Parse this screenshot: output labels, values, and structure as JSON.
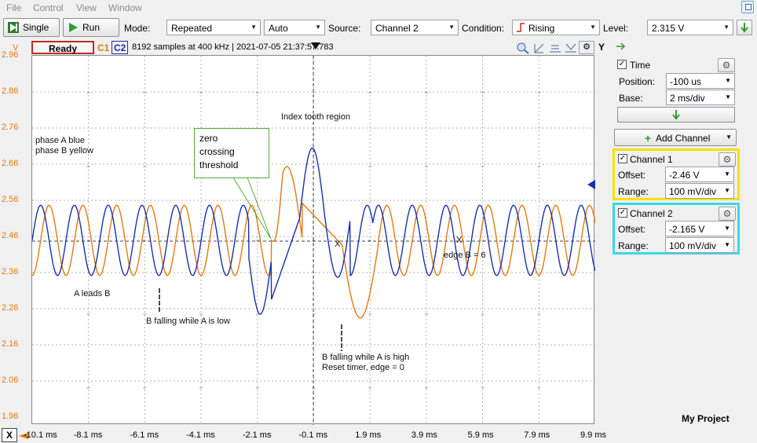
{
  "menu": {
    "file": "File",
    "control": "Control",
    "view": "View",
    "window": "Window"
  },
  "toolbar": {
    "single": "Single",
    "run": "Run",
    "mode_label": "Mode:",
    "mode_value": "Repeated",
    "auto_value": "Auto",
    "source_label": "Source:",
    "source_value": "Channel 2",
    "condition_label": "Condition:",
    "condition_value": "Rising",
    "level_label": "Level:",
    "level_value": "2.315 V"
  },
  "status": {
    "ready": "Ready",
    "c1": "C1",
    "c2": "C2",
    "samples": "8192 samples at 400 kHz | 2021-07-05 21:37:57.783",
    "vunit": "V",
    "y_button": "Y",
    "x_button": "X"
  },
  "annotations": {
    "phase_a": "phase A blue",
    "phase_b": "phase B yellow",
    "zero_1": "zero",
    "zero_2": "crossing",
    "zero_3": "threshold",
    "index": "Index tooth region",
    "a_leads": "A leads B",
    "b_falling_low": "B falling while A is low",
    "b_falling_high": "B falling while A is high",
    "reset": "Reset timer, edge = 0",
    "edge_b": "edge B = 6",
    "marker_x1": "X",
    "marker_x2": "X"
  },
  "side": {
    "time": "Time",
    "position_label": "Position:",
    "position_value": "-100 us",
    "base_label": "Base:",
    "base_value": "2 ms/div",
    "add_channel": "Add Channel",
    "ch1": "Channel 1",
    "ch1_offset_label": "Offset:",
    "ch1_offset": "-2.46 V",
    "ch1_range_label": "Range:",
    "ch1_range": "100 mV/div",
    "ch2": "Channel 2",
    "ch2_offset_label": "Offset:",
    "ch2_offset": "-2.165 V",
    "ch2_range_label": "Range:",
    "ch2_range": "100 mV/div",
    "project": "My Project"
  },
  "colors": {
    "channel1": "#e07b10",
    "channel2": "#1a2fb0",
    "ch1_border": "#f2e400",
    "ch2_border": "#3ad8e6"
  },
  "chart_data": {
    "type": "line",
    "yticks": [
      "2.96",
      "2.86",
      "2.76",
      "2.66",
      "2.56",
      "2.46",
      "2.36",
      "2.26",
      "2.16",
      "2.06",
      "1.96"
    ],
    "xticks": [
      "-10.1 ms",
      "-8.1 ms",
      "-6.1 ms",
      "-4.1 ms",
      "-2.1 ms",
      "-0.1 ms",
      "1.9 ms",
      "3.9 ms",
      "5.9 ms",
      "7.9 ms",
      "9.9 ms"
    ],
    "ylim": [
      1.96,
      2.96
    ],
    "xlim": [
      -10.1,
      9.9
    ],
    "series": [
      {
        "name": "Channel 1",
        "color": "#e07b10"
      },
      {
        "name": "Channel 2",
        "color": "#1a2fb0"
      }
    ]
  }
}
